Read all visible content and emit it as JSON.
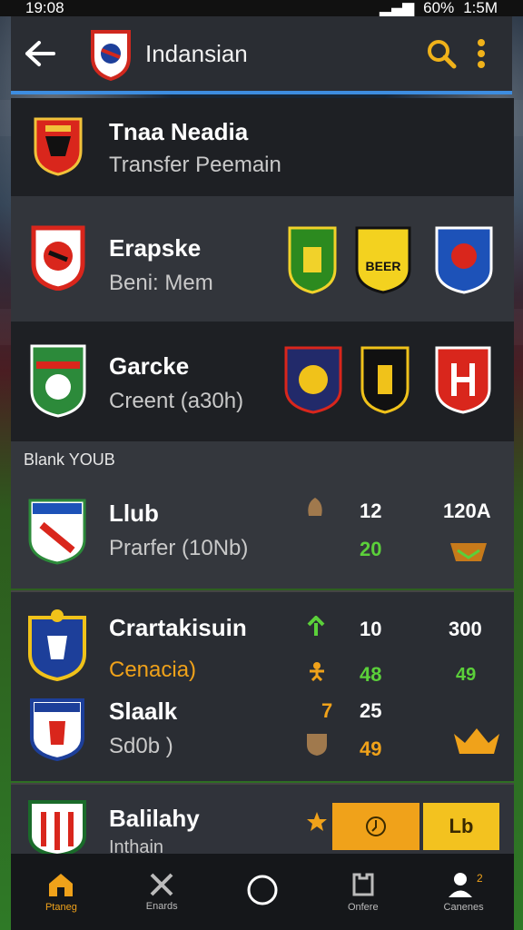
{
  "status": {
    "time": "19:08",
    "battery": "60%",
    "clock": "1:5M"
  },
  "appbar": {
    "title": "Indansian"
  },
  "rows": [
    {
      "name": "Tnaa Neadia",
      "sub": "Transfer Peemain"
    },
    {
      "name": "Erapske",
      "sub": "Beni: Mem",
      "badge": "BEER"
    },
    {
      "name": "Garcke",
      "sub": "Creent (a30h)"
    }
  ],
  "section": {
    "label": "Blank YOUB"
  },
  "club": {
    "name": "Llub",
    "sub": "Prarfer (10Nb)",
    "stat1": "12",
    "stat2": "20",
    "stat3": "120A"
  },
  "group": [
    {
      "name": "Crartakisuin",
      "sub": "Cenacia)",
      "a": "10",
      "b": "48",
      "c": "300",
      "d": "49"
    },
    {
      "name": "Slaalk",
      "sub": "Sd0b )",
      "num": "7",
      "a": "25",
      "b": "49"
    }
  ],
  "last": {
    "name": "Balilahy",
    "sub": "Inthain",
    "btn2": "Lb"
  },
  "nav": [
    {
      "label": "Ptaneg"
    },
    {
      "label": "Enards"
    },
    {
      "label": ""
    },
    {
      "label": "Onfere"
    },
    {
      "label": "Canenes"
    }
  ],
  "colors": {
    "accent": "#f0a21a",
    "green": "#5bd03a",
    "blue_rule": "#3d8de0"
  }
}
